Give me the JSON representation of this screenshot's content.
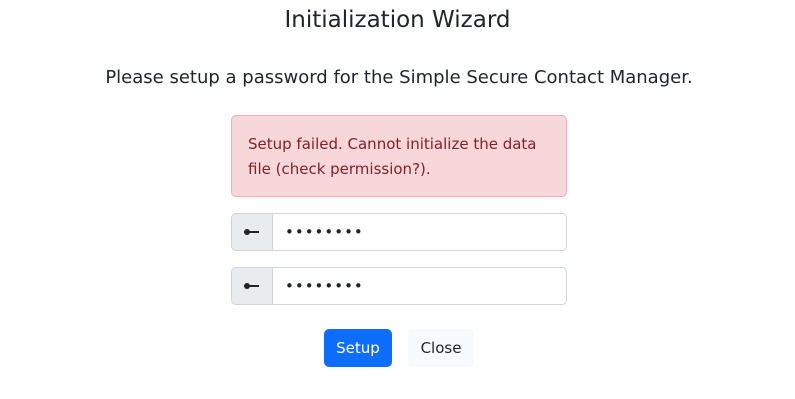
{
  "wizard": {
    "title": "Initialization Wizard",
    "subtitle": "Please setup a password for the Simple Secure Contact Manager."
  },
  "alert": {
    "message": "Setup failed. Cannot initialize the data file (check permission?).",
    "type": "danger"
  },
  "form": {
    "password": {
      "value": "password",
      "icon": "key-icon"
    },
    "confirm_password": {
      "value": "password",
      "icon": "key-icon"
    }
  },
  "buttons": {
    "setup_label": "Setup",
    "close_label": "Close"
  },
  "colors": {
    "primary": "#0d6efd",
    "danger_bg": "#f8d7da",
    "danger_text": "#842029"
  }
}
